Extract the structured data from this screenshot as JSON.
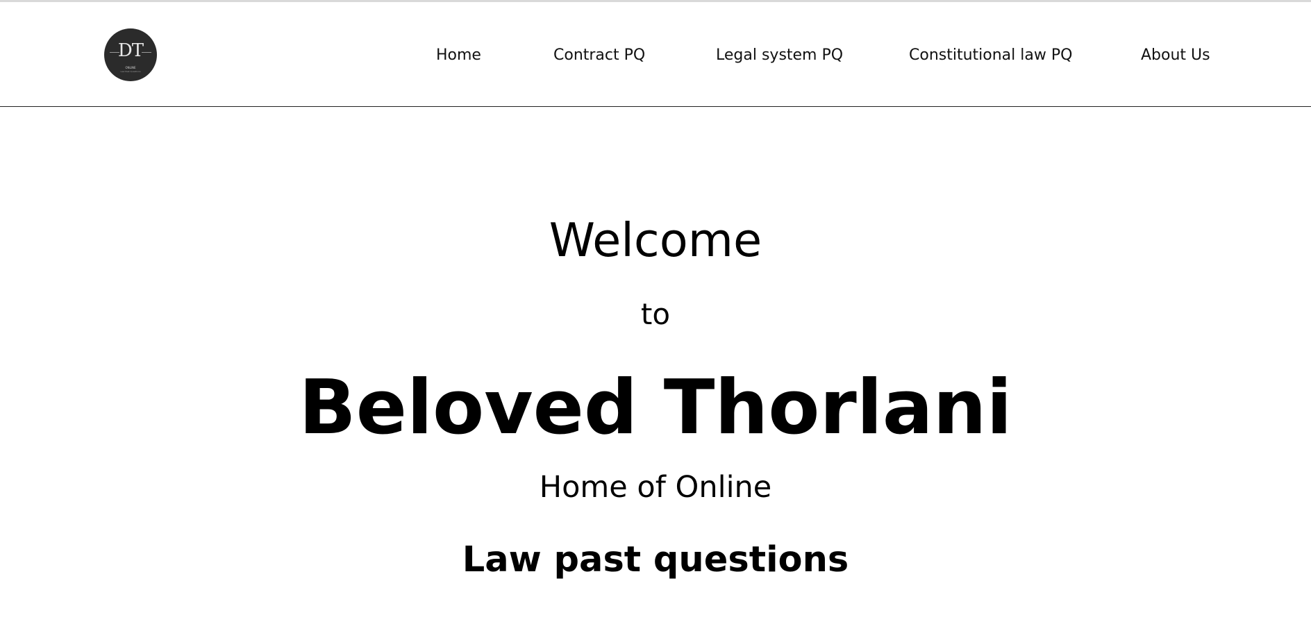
{
  "brand": {
    "logo_letters": "DT",
    "logo_line1": "ONLINE",
    "logo_line2": "Law Past Questions"
  },
  "nav": {
    "items": [
      {
        "label": "Home"
      },
      {
        "label": "Contract PQ"
      },
      {
        "label": "Legal system PQ"
      },
      {
        "label": "Constitutional law PQ"
      },
      {
        "label": "About Us"
      }
    ]
  },
  "hero": {
    "welcome": "Welcome",
    "to": "to",
    "name": "Beloved Thorlani",
    "tagline_1": "Home of Online",
    "tagline_2": "Law past questions"
  }
}
